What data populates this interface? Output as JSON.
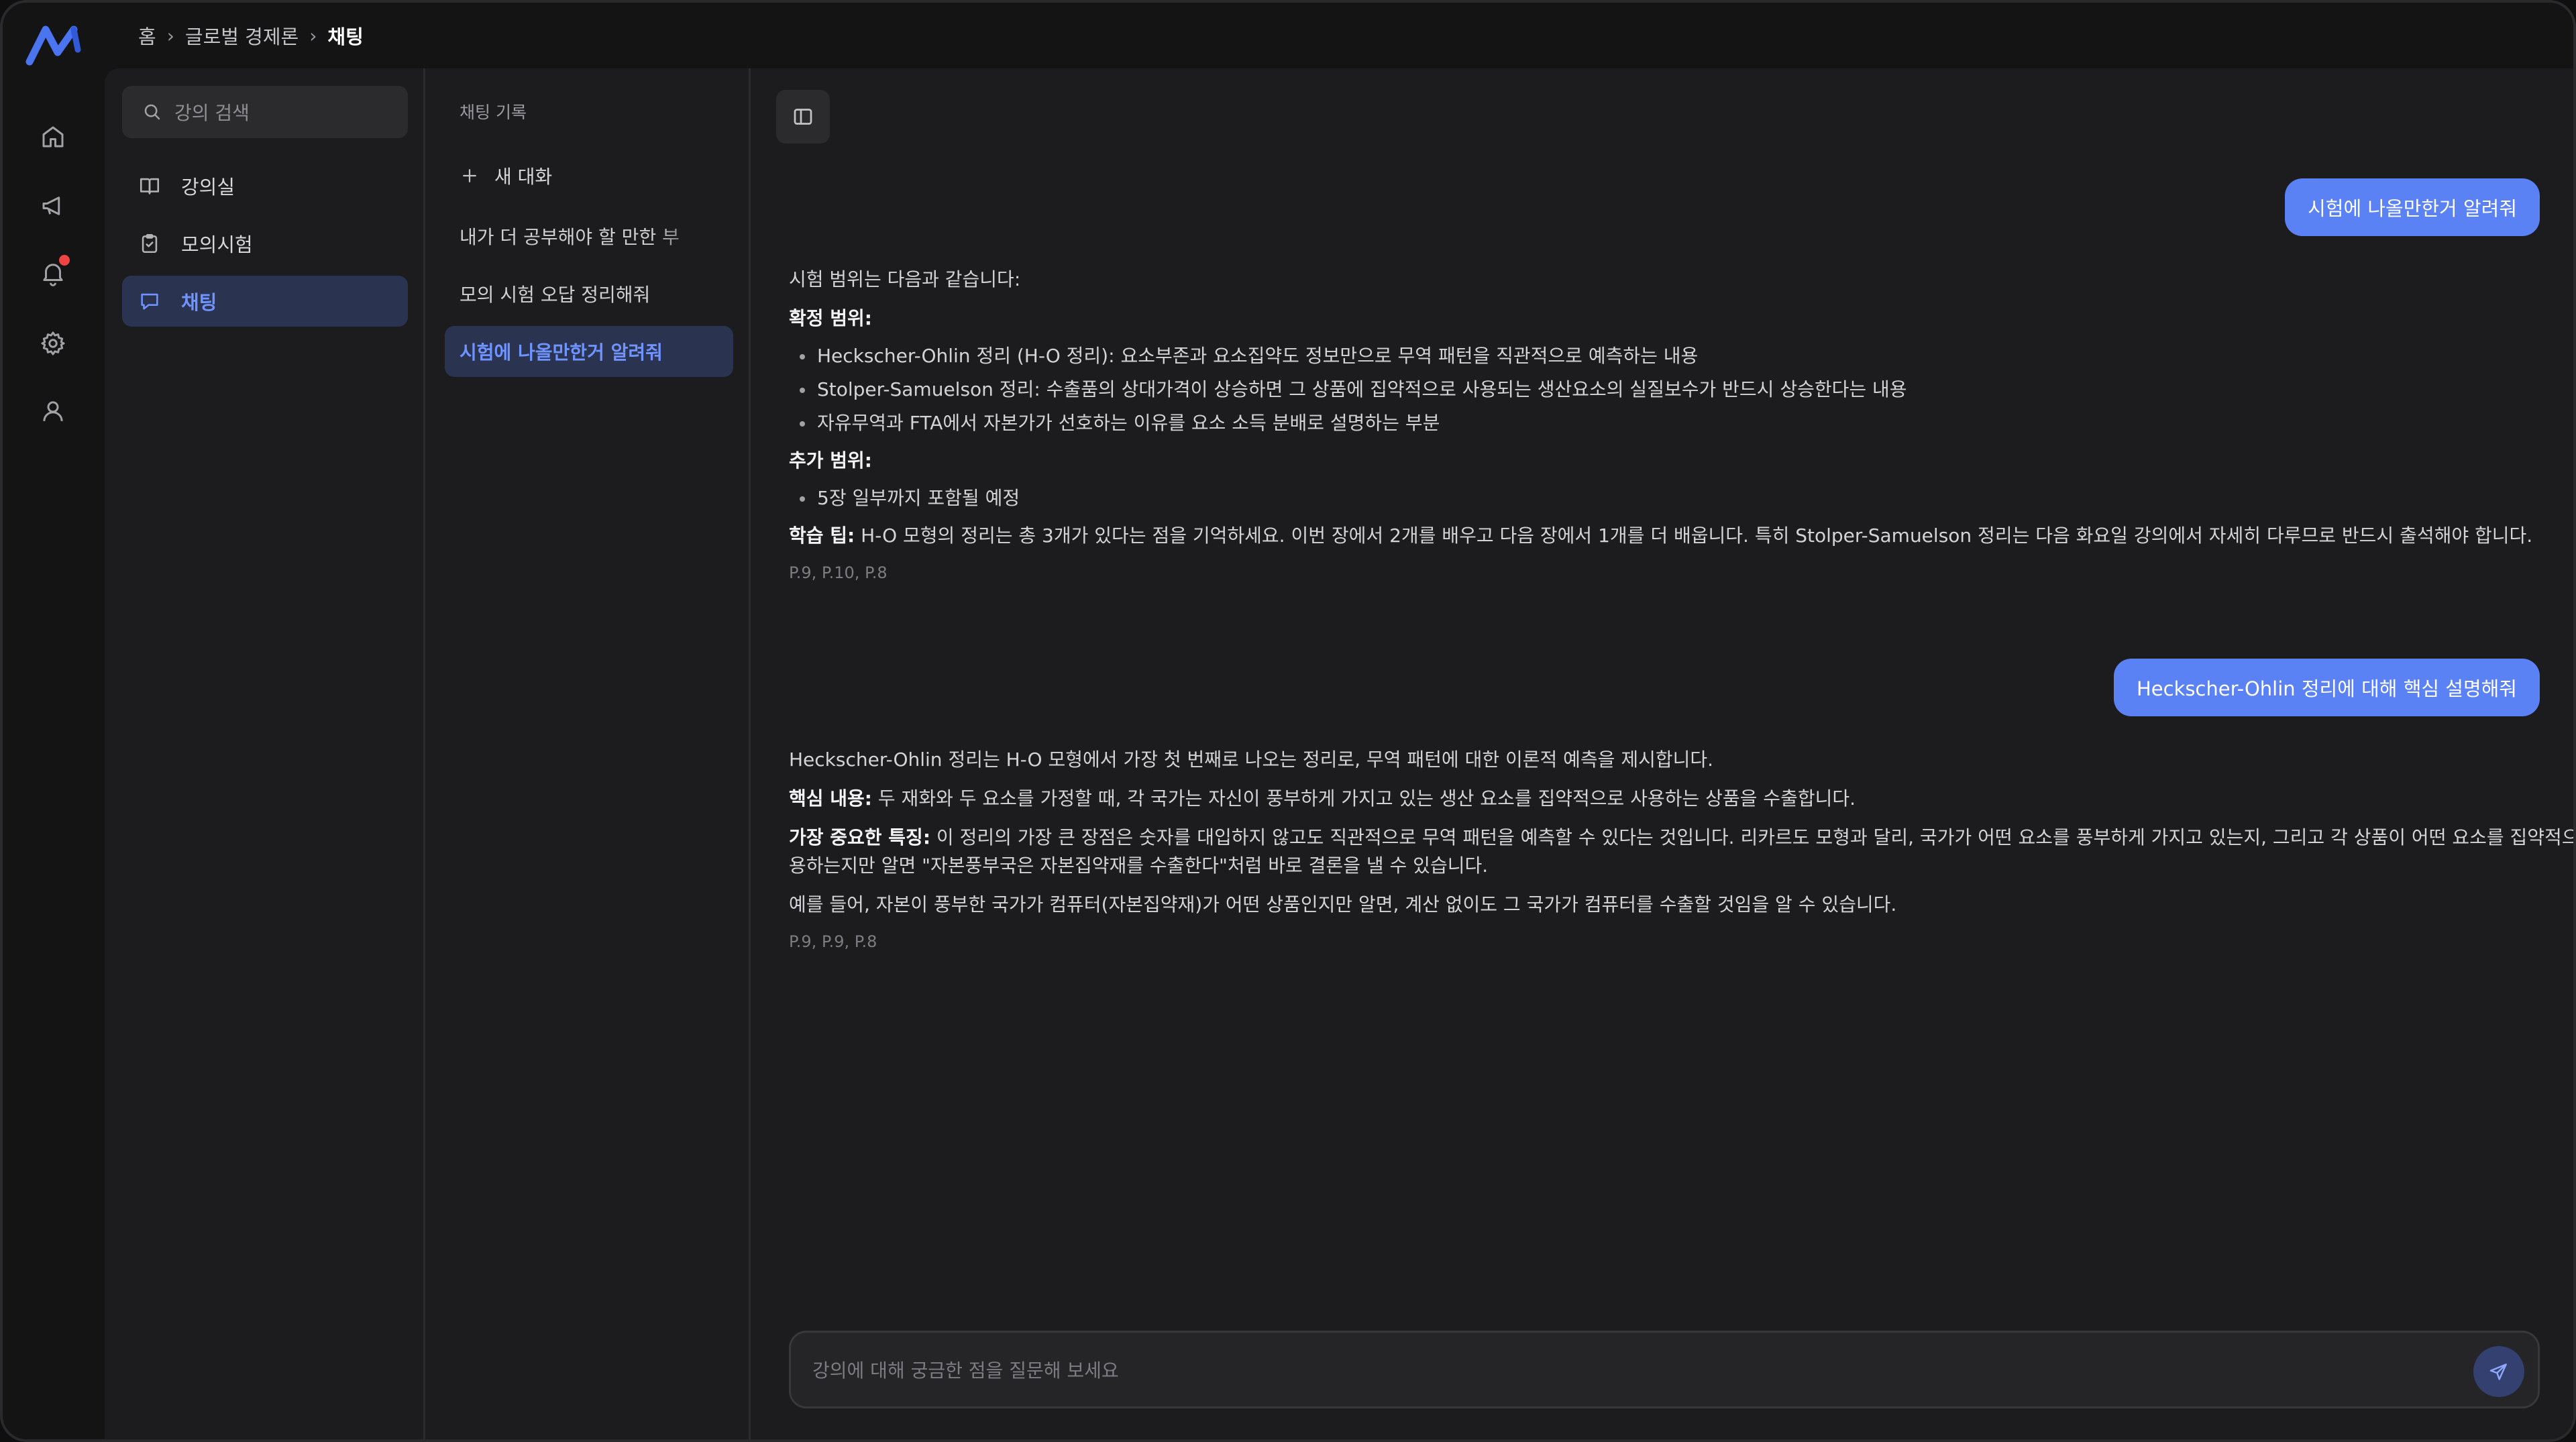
{
  "breadcrumb": [
    "홈",
    "글로벌 경제론",
    "채팅"
  ],
  "sidebar": {
    "search_placeholder": "강의 검색",
    "items": [
      {
        "label": "강의실",
        "icon": "book-icon"
      },
      {
        "label": "모의시험",
        "icon": "clipboard-check-icon"
      },
      {
        "label": "채팅",
        "icon": "chat-icon",
        "active": true
      }
    ]
  },
  "history": {
    "title": "채팅 기록",
    "new_chat": "새 대화",
    "items": [
      {
        "label": "내가 더 공부해야 할 만한 부"
      },
      {
        "label": "모의 시험 오답 정리해줘"
      },
      {
        "label": "시험에 나올만한거 알려줘",
        "active": true
      }
    ]
  },
  "messages": {
    "q1": "시험에 나올만한거 알려줘",
    "a1": {
      "intro": "시험 범위는 다음과 같습니다:",
      "heading1": "확정 범위:",
      "bullets1": [
        "Heckscher-Ohlin 정리 (H-O 정리): 요소부존과 요소집약도 정보만으로 무역 패턴을 직관적으로 예측하는 내용",
        "Stolper-Samuelson 정리: 수출품의 상대가격이 상승하면 그 상품에 집약적으로 사용되는 생산요소의 실질보수가 반드시 상승한다는 내용",
        "자유무역과 FTA에서 자본가가 선호하는 이유를 요소 소득 분배로 설명하는 부분"
      ],
      "heading2": "추가 범위:",
      "bullets2": [
        "5장 일부까지 포함될 예정"
      ],
      "tip_label": "학습 팁:",
      "tip_text": " H-O 모형의 정리는 총 3개가 있다는 점을 기억하세요. 이번 장에서 2개를 배우고 다음 장에서 1개를 더 배웁니다. 특히 Stolper-Samuelson 정리는 다음 화요일 강의에서 자세히 다루므로 반드시 출석해야 합니다.",
      "refs": "P.9, P.10, P.8"
    },
    "q2": "Heckscher-Ohlin 정리에 대해 핵심 설명해줘",
    "a2": {
      "intro": "Heckscher-Ohlin 정리는 H-O 모형에서 가장 첫 번째로 나오는 정리로, 무역 패턴에 대한 이론적 예측을 제시합니다.",
      "core_label": "핵심 내용:",
      "core_text": " 두 재화와 두 요소를 가정할 때, 각 국가는 자신이 풍부하게 가지고 있는 생산 요소를 집약적으로 사용하는 상품을 수출합니다.",
      "feature_label": "가장 중요한 특징:",
      "feature_text": " 이 정리의 가장 큰 장점은 숫자를 대입하지 않고도 직관적으로 무역 패턴을 예측할 수 있다는 것입니다. 리카르도 모형과 달리, 국가가 어떤 요소를 풍부하게 가지고 있는지, 그리고 각 상품이 어떤 요소를 집약적으로 사용하는지만 알면 \"자본풍부국은 자본집약재를 수출한다\"처럼 바로 결론을 낼 수 있습니다.",
      "example": "예를 들어, 자본이 풍부한 국가가 컴퓨터(자본집약재)가 어떤 상품인지만 알면, 계산 없이도 그 국가가 컴퓨터를 수출할 것임을 알 수 있습니다.",
      "refs": "P.9, P.9, P.8"
    }
  },
  "composer": {
    "placeholder": "강의에 대해 궁금한 점을 질문해 보세요"
  },
  "colors": {
    "accent": "#5b82f5",
    "active_bg": "#2a3350",
    "active_text": "#6f93ff",
    "notification": "#ef4444"
  }
}
